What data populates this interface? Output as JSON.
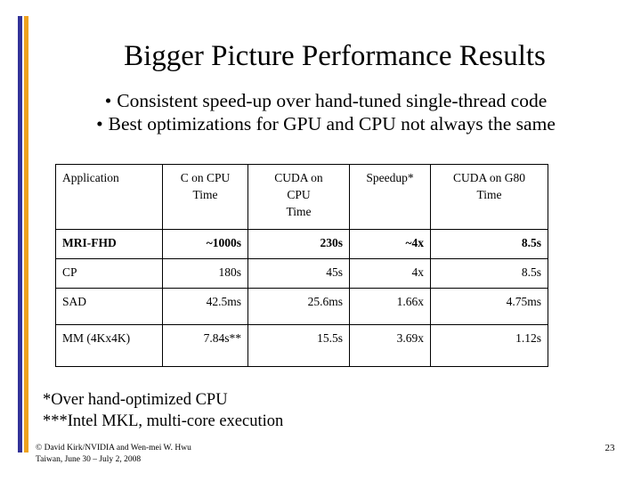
{
  "slide": {
    "title": "Bigger Picture Performance Results",
    "bullet_glyph": "•",
    "bullets": [
      "Consistent speed-up over hand-tuned single-thread code",
      "Best optimizations for GPU and CPU not always the same"
    ],
    "accents": {
      "blue": "#333399",
      "orange": "#EFA21E"
    },
    "footnotes": [
      "*Over hand-optimized CPU",
      "***Intel MKL, multi-core execution"
    ],
    "footer": {
      "credit_line1": "© David Kirk/NVIDIA and Wen-mei W. Hwu",
      "credit_line2": "Taiwan, June 30 – July 2, 2008",
      "page_number": "23"
    }
  },
  "table": {
    "headers": [
      "Application",
      "C on CPU\nTime",
      "CUDA on\nCPU\nTime",
      "Speedup*",
      "CUDA on G80\nTime"
    ],
    "headers_lines": {
      "h0": [
        "Application"
      ],
      "h1": [
        "C on CPU",
        "Time"
      ],
      "h2": [
        "CUDA on",
        "CPU",
        "Time"
      ],
      "h3": [
        "Speedup*"
      ],
      "h4": [
        "CUDA on G80",
        "Time"
      ]
    },
    "rows": [
      {
        "application": "MRI-FHD",
        "c_on_cpu_time": "~1000s",
        "cuda_on_cpu_time": "230s",
        "speedup": "~4x",
        "cuda_on_g80_time": "8.5s",
        "bold": true
      },
      {
        "application": "CP",
        "c_on_cpu_time": "180s",
        "cuda_on_cpu_time": "45s",
        "speedup": "4x",
        "cuda_on_g80_time": "8.5s",
        "bold": false
      },
      {
        "application": "SAD",
        "c_on_cpu_time": "42.5ms",
        "cuda_on_cpu_time": "25.6ms",
        "speedup": "1.66x",
        "cuda_on_g80_time": "4.75ms",
        "bold": false
      },
      {
        "application": "MM (4Kx4K)",
        "c_on_cpu_time": "7.84s**",
        "cuda_on_cpu_time": "15.5s",
        "speedup": "3.69x",
        "cuda_on_g80_time": "1.12s",
        "bold": false
      }
    ]
  }
}
